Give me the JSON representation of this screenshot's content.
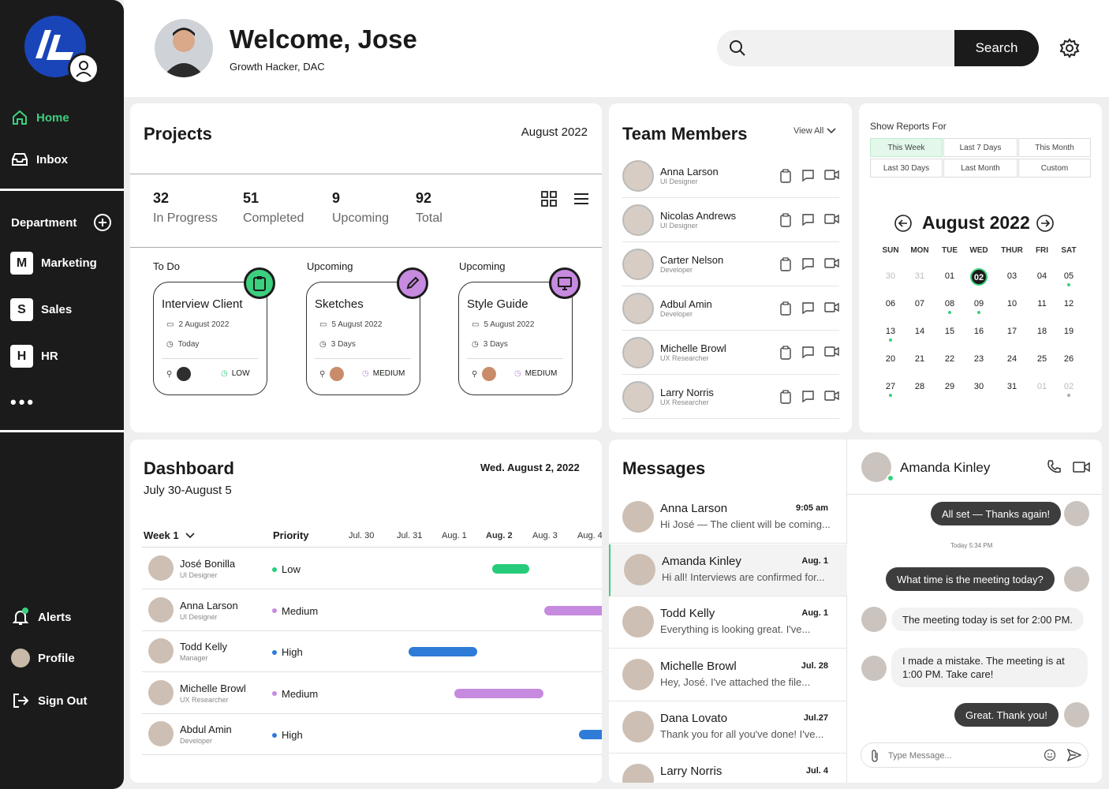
{
  "sidebar": {
    "nav": [
      {
        "label": "Home",
        "icon": "home-icon"
      },
      {
        "label": "Inbox",
        "icon": "inbox-icon"
      }
    ],
    "department_label": "Department",
    "departments": [
      {
        "letter": "M",
        "label": "Marketing"
      },
      {
        "letter": "S",
        "label": "Sales"
      },
      {
        "letter": "H",
        "label": "HR"
      }
    ],
    "more": "•••",
    "bottom": [
      {
        "label": "Alerts"
      },
      {
        "label": "Profile"
      },
      {
        "label": "Sign Out"
      }
    ]
  },
  "header": {
    "welcome": "Welcome, Jose",
    "role": "Growth Hacker, DAC",
    "search_placeholder": "",
    "search_button": "Search"
  },
  "projects": {
    "title": "Projects",
    "date": "August 2022",
    "stats": [
      {
        "num": "32",
        "label": "In Progress"
      },
      {
        "num": "51",
        "label": "Completed"
      },
      {
        "num": "9",
        "label": "Upcoming"
      },
      {
        "num": "92",
        "label": "Total"
      }
    ],
    "tasks": [
      {
        "status": "To Do",
        "title": "Interview Client",
        "date": "2 August 2022",
        "due": "Today",
        "priority": "LOW"
      },
      {
        "status": "Upcoming",
        "title": "Sketches",
        "date": "5 August 2022",
        "due": "3 Days",
        "priority": "MEDIUM"
      },
      {
        "status": "Upcoming",
        "title": "Style Guide",
        "date": "5 August 2022",
        "due": "3 Days",
        "priority": "MEDIUM"
      }
    ]
  },
  "team": {
    "title": "Team Members",
    "view_all": "View All",
    "members": [
      {
        "name": "Anna Larson",
        "role": "UI Designer"
      },
      {
        "name": "Nicolas Andrews",
        "role": "UI Designer"
      },
      {
        "name": "Carter Nelson",
        "role": "Developer"
      },
      {
        "name": "Adbul Amin",
        "role": "Developer"
      },
      {
        "name": "Michelle Browl",
        "role": "UX Researcher"
      },
      {
        "name": "Larry Norris",
        "role": "UX Researcher"
      }
    ]
  },
  "reports": {
    "label": "Show Reports For",
    "tabs": [
      "This Week",
      "Last 7 Days",
      "This Month",
      "Last 30 Days",
      "Last Month",
      "Custom"
    ],
    "active_tab": "This Week"
  },
  "calendar": {
    "month": "August 2022",
    "weekdays": [
      "SUN",
      "MON",
      "TUE",
      "WED",
      "THUR",
      "FRI",
      "SAT"
    ],
    "weeks": [
      [
        "30",
        "31",
        "01",
        "02",
        "03",
        "04",
        "05"
      ],
      [
        "06",
        "07",
        "08",
        "09",
        "10",
        "11",
        "12"
      ],
      [
        "13",
        "14",
        "15",
        "16",
        "17",
        "18",
        "19"
      ],
      [
        "20",
        "21",
        "22",
        "23",
        "24",
        "25",
        "26"
      ],
      [
        "27",
        "28",
        "29",
        "30",
        "31",
        "01",
        "02"
      ]
    ],
    "selected": "02"
  },
  "dashboard": {
    "title": "Dashboard",
    "range": "July 30-August 5",
    "date": "Wed. August 2, 2022",
    "week": "Week 1",
    "priority_header": "Priority",
    "days": [
      "Jul. 30",
      "Jul. 31",
      "Aug. 1",
      "Aug. 2",
      "Aug. 3",
      "Aug. 4"
    ],
    "rows": [
      {
        "name": "José Bonilla",
        "role": "UI Designer",
        "priority": "Low"
      },
      {
        "name": "Anna Larson",
        "role": "UI Designer",
        "priority": "Medium"
      },
      {
        "name": "Todd Kelly",
        "role": "Manager",
        "priority": "High"
      },
      {
        "name": "Michelle Browl",
        "role": "UX Researcher",
        "priority": "Medium"
      },
      {
        "name": "Abdul Amin",
        "role": "Developer",
        "priority": "High"
      }
    ]
  },
  "messages": {
    "title": "Messages",
    "items": [
      {
        "name": "Anna Larson",
        "time": "9:05 am",
        "preview": "Hi José — The client will be coming..."
      },
      {
        "name": "Amanda Kinley",
        "time": "Aug. 1",
        "preview": "Hi all! Interviews are confirmed for..."
      },
      {
        "name": "Todd Kelly",
        "time": "Aug. 1",
        "preview": "Everything is looking great. I've..."
      },
      {
        "name": "Michelle Browl",
        "time": "Jul. 28",
        "preview": "Hey, José. I've attached the file..."
      },
      {
        "name": "Dana Lovato",
        "time": "Jul.27",
        "preview": "Thank you for all you've done! I've..."
      },
      {
        "name": "Larry Norris",
        "time": "Jul. 4",
        "preview": ""
      }
    ]
  },
  "chat": {
    "contact": "Amanda Kinley",
    "msg1": "All set — Thanks again!",
    "timestamp": "Today 5:34 PM",
    "msg2": "What time is the meeting today?",
    "msg3": "The meeting today is set for 2:00 PM.",
    "msg4a": "I made a mistake. The meeting is at",
    "msg4b": "1:00 PM. Take care!",
    "msg5": "Great. Thank you!",
    "input_placeholder": "Type Message..."
  },
  "colors": {
    "accent": "#3ccf7e",
    "dark": "#1b1b1b",
    "low": "#27cc7a",
    "medium": "#c68adf",
    "high": "#2f7bd8",
    "logo": "#1a45b8"
  }
}
